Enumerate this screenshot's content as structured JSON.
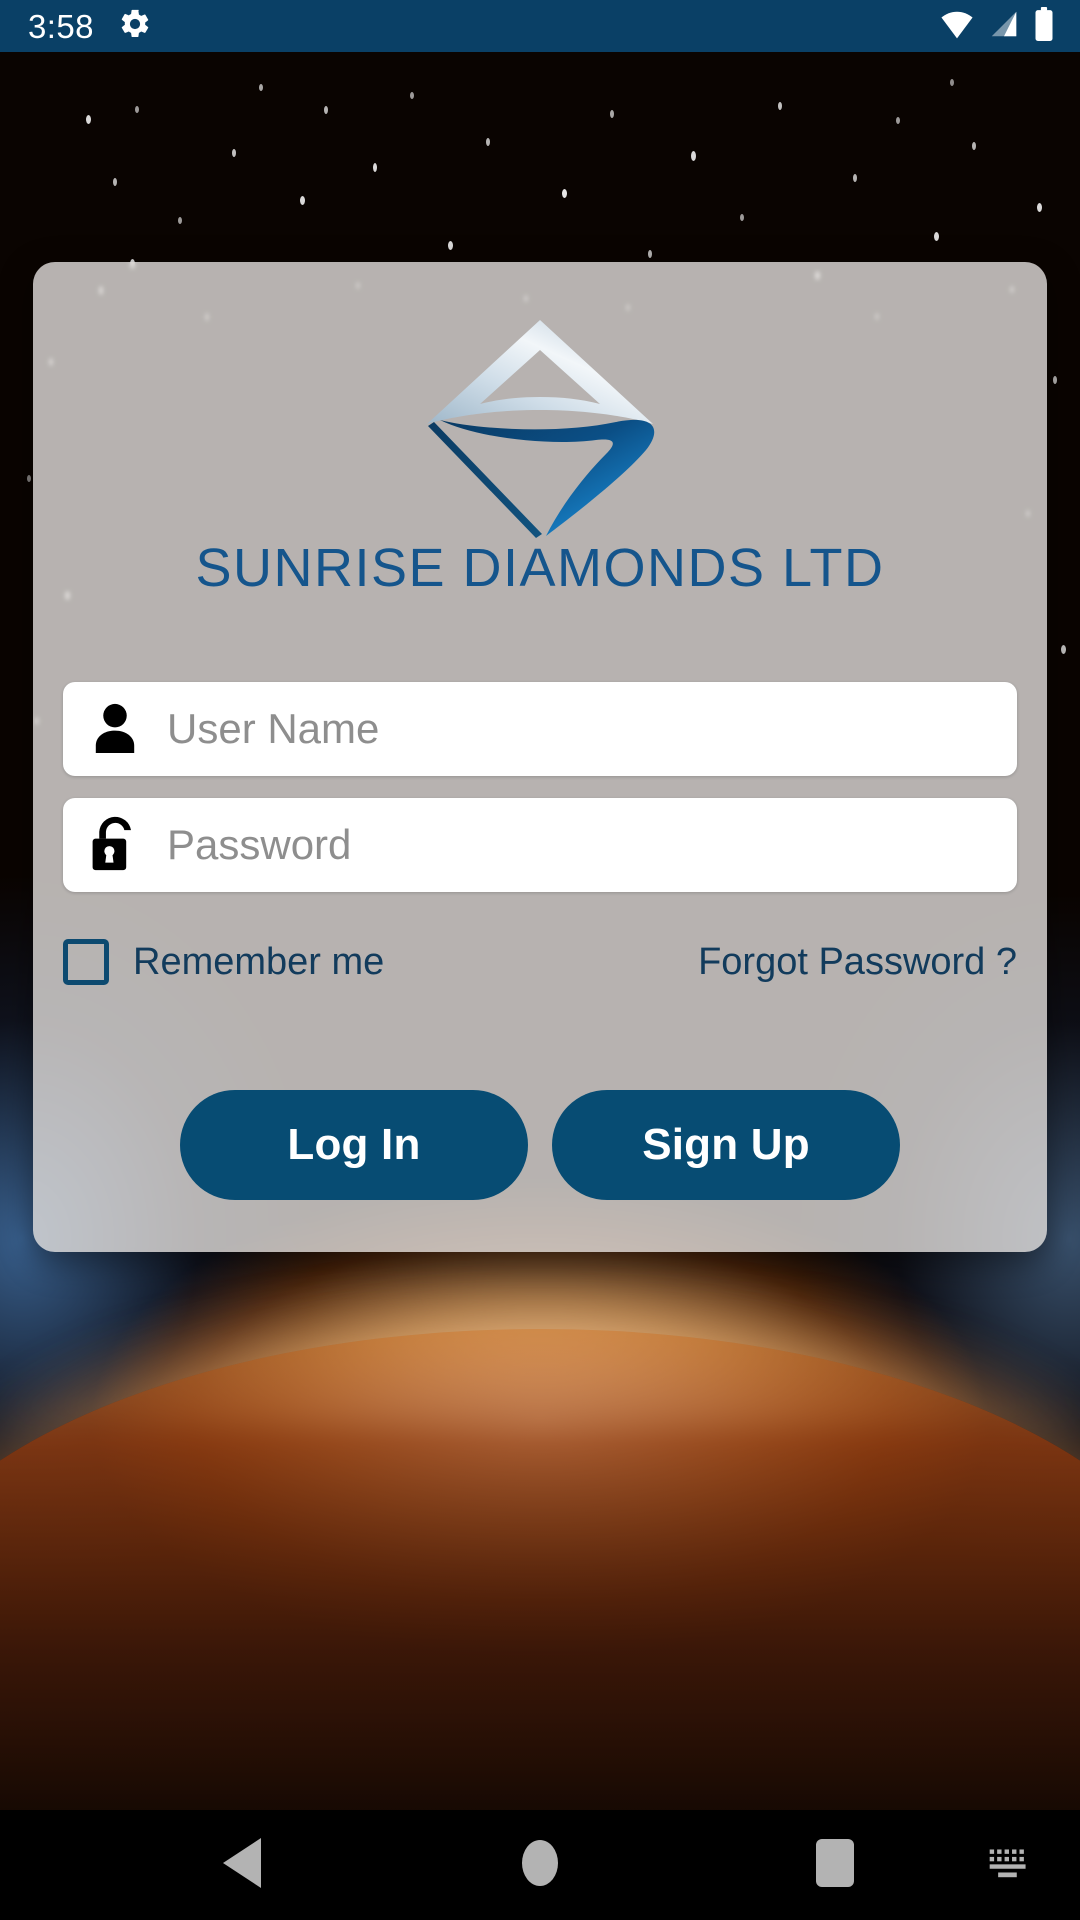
{
  "status_bar": {
    "time": "3:58",
    "icons": [
      "gear-icon",
      "wifi-icon",
      "cellular-signal-icon",
      "battery-icon"
    ],
    "background_color": "#0a4066"
  },
  "brand": {
    "name": "SUNRISE DIAMONDS LTD",
    "logo_name": "sunrise-diamonds-logo",
    "text_color": "#15558c",
    "logo_top_color": "#dfe8ef",
    "logo_bottom_color": "#0b3f6b",
    "logo_accent_color": "#1b8fe0"
  },
  "form": {
    "username": {
      "placeholder": "User Name",
      "value": "",
      "icon": "user-icon"
    },
    "password": {
      "placeholder": "Password",
      "value": "",
      "icon": "unlocked-padlock-icon"
    },
    "remember_me": {
      "label": "Remember me",
      "checked": false
    },
    "forgot_password": {
      "label": "Forgot Password ?"
    },
    "login_button": {
      "label": "Log In"
    },
    "signup_button": {
      "label": "Sign Up"
    },
    "accent_color": "#074c73",
    "card_background": "rgba(226,222,220,0.80)"
  },
  "nav_bar": {
    "back_label": "Back",
    "home_label": "Home",
    "recents_label": "Recents",
    "keyboard_label": "Keyboard",
    "background_color": "#000000",
    "icon_color": "#b3b3b3"
  }
}
